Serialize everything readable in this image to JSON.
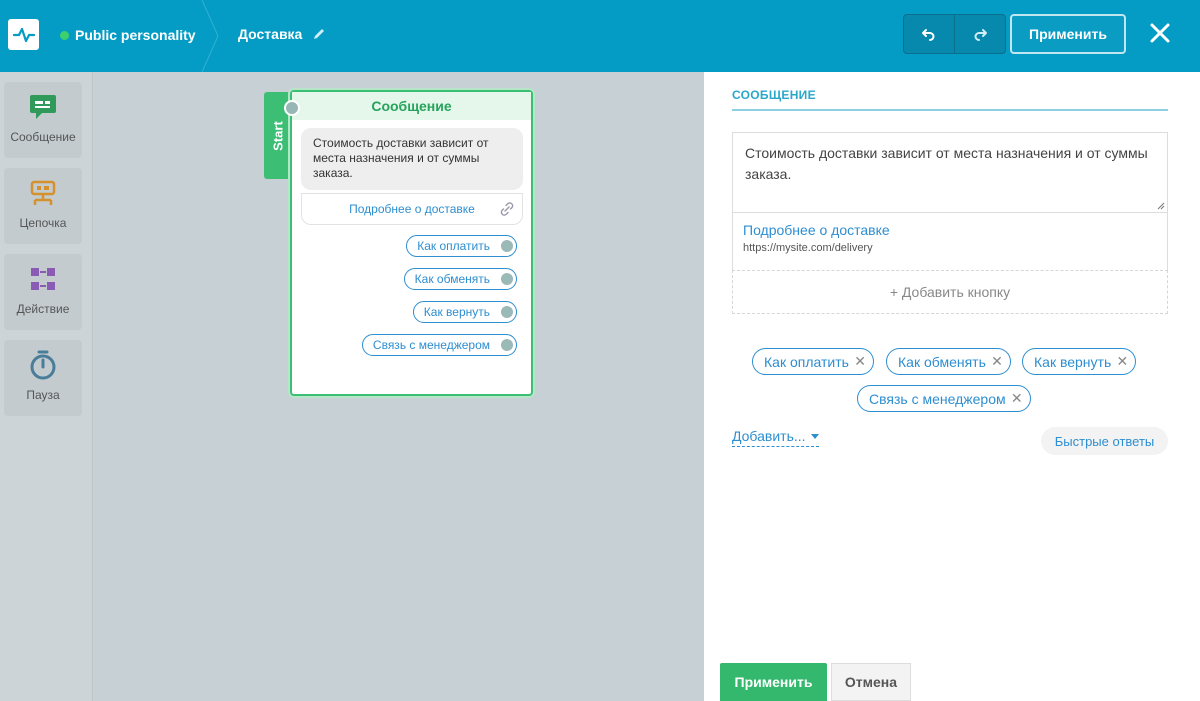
{
  "header": {
    "bot_name": "Public personality",
    "flow_title": "Доставка",
    "apply_label": "Применить"
  },
  "sidebar": {
    "tools": [
      {
        "label": "Сообщение",
        "icon": "message-icon",
        "color": "#2f9a5a"
      },
      {
        "label": "Цепочка",
        "icon": "chain-icon",
        "color": "#d4912d"
      },
      {
        "label": "Действие",
        "icon": "action-icon",
        "color": "#8a5bb5"
      },
      {
        "label": "Пауза",
        "icon": "pause-timer-icon",
        "color": "#4a7d9a"
      }
    ]
  },
  "canvas": {
    "start_label": "Start",
    "node": {
      "title": "Сообщение",
      "text": "Стоимость доставки зависит от места назначения и от суммы заказа.",
      "link_label": "Подробнее о доставке",
      "quick_replies": [
        "Как оплатить",
        "Как обменять",
        "Как вернуть",
        "Связь с менеджером"
      ]
    }
  },
  "panel": {
    "title": "СООБЩЕНИЕ",
    "message_text": "Стоимость доставки зависит от места назначения и от суммы заказа.",
    "button": {
      "title": "Подробнее о доставке",
      "url": "https://mysite.com/delivery"
    },
    "add_button_label": "+ Добавить кнопку",
    "quick_replies": [
      "Как оплатить",
      "Как обменять",
      "Как вернуть",
      "Связь с менеджером"
    ],
    "add_more_label": "Добавить...",
    "quick_replies_tag": "Быстрые ответы",
    "apply_label": "Применить",
    "cancel_label": "Отмена"
  },
  "colors": {
    "header_bg": "#049cc4",
    "accent_green": "#3cbf75",
    "link_blue": "#2d8ed0"
  }
}
